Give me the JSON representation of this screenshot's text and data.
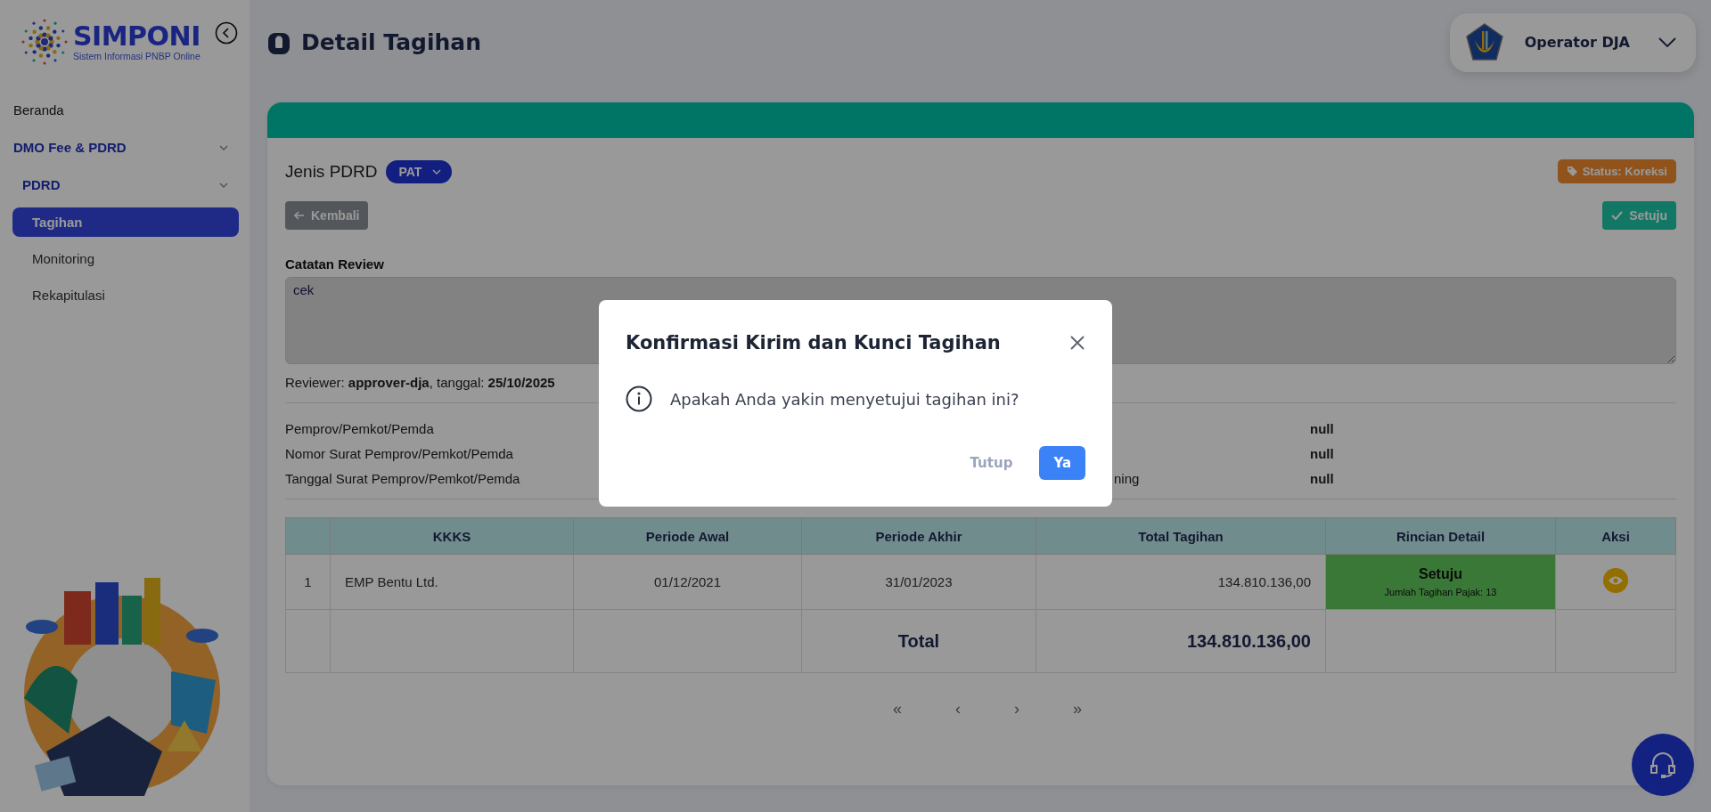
{
  "sidebar": {
    "logo": {
      "title": "SIMPONI",
      "subtitle": "Sistem Informasi PNBP Online"
    },
    "items": [
      {
        "label": "Beranda",
        "selected": false
      },
      {
        "label": "DMO Fee & PDRD",
        "selected": false,
        "expanded": true,
        "children": [
          {
            "label": "PDRD",
            "selected": false,
            "expanded": true,
            "children": [
              {
                "label": "Tagihan",
                "selected": true
              },
              {
                "label": "Monitoring",
                "selected": false
              },
              {
                "label": "Rekapitulasi",
                "selected": false
              }
            ]
          }
        ]
      }
    ]
  },
  "header": {
    "title": "Detail Tagihan",
    "user": {
      "name": "Operator DJA"
    }
  },
  "card": {
    "jenis_label": "Jenis PDRD",
    "jenis_value": "PAT",
    "status": "Status: Koreksi",
    "back_button": "Kembali",
    "approve_button": "Setuju",
    "review": {
      "label": "Catatan Review",
      "value": "cek",
      "reviewer": "Reviewer: **approver-dja**, tanggal: **25/10/2025**"
    },
    "info_rows": [
      {
        "label": "Pemprov/Pemkot/Pemda",
        "value": "null"
      },
      {
        "label": "Nomor Surat Pemprov/Pemkot/Pemda",
        "value": "null"
      },
      {
        "label": "Tanggal Surat Pemprov/Pemkot/Pemda",
        "label_2": "ning",
        "value": "null"
      }
    ],
    "table": {
      "columns": [
        "KKKS",
        "Periode Awal",
        "Periode Akhir",
        "Total Tagihan",
        "Rincian Detail",
        "Aksi"
      ],
      "rows": [
        {
          "no": "1",
          "kkks": "EMP Bentu Ltd.",
          "periode_awal": "01/12/2021",
          "periode_akhir": "31/01/2023",
          "total": "134.810.136,00",
          "detail": {
            "status": "Setuju",
            "note": "Jumlah Tagihan Pajak: 13"
          }
        }
      ],
      "total": {
        "label": "Total",
        "value": "134.810.136,00"
      }
    },
    "pagination": [
      "«",
      "‹",
      "›",
      "»"
    ]
  },
  "modal": {
    "title": "Konfirmasi Kirim dan Kunci Tagihan",
    "message": "Apakah Anda yakin menyetujui tagihan ini?",
    "cancel_button": "Tutup",
    "confirm_button": "Ya"
  }
}
